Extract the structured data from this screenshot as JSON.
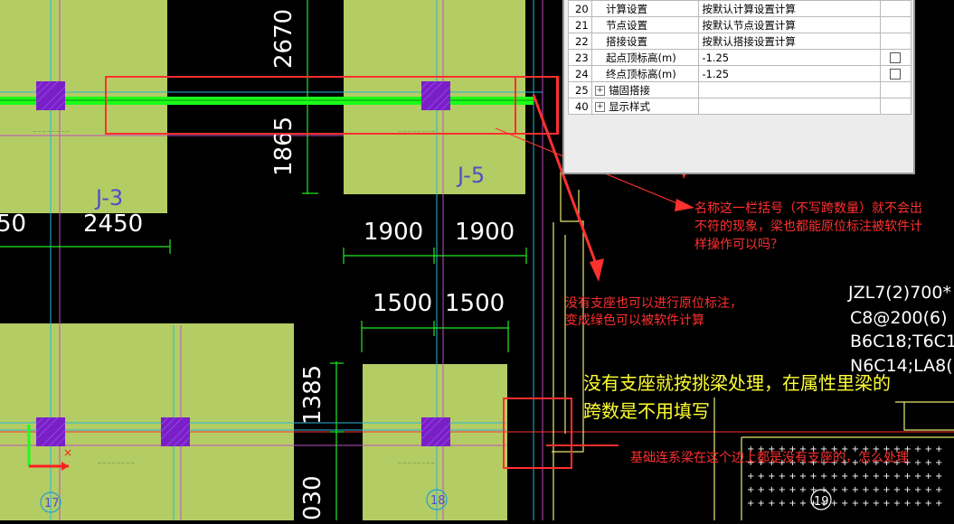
{
  "property_table": {
    "rows": [
      {
        "no": "20",
        "name": "计算设置",
        "value": "按默认计算设置计算",
        "indent": true,
        "expander": false,
        "checkbox": false
      },
      {
        "no": "21",
        "name": "节点设置",
        "value": "按默认节点设置计算",
        "indent": true,
        "expander": false,
        "checkbox": false
      },
      {
        "no": "22",
        "name": "搭接设置",
        "value": "按默认搭接设置计算",
        "indent": true,
        "expander": false,
        "checkbox": false
      },
      {
        "no": "23",
        "name": "起点顶标高(m)",
        "value": "-1.25",
        "indent": true,
        "expander": false,
        "checkbox": true
      },
      {
        "no": "24",
        "name": "终点顶标高(m)",
        "value": "-1.25",
        "indent": true,
        "expander": false,
        "checkbox": true
      },
      {
        "no": "25",
        "name": "锚固搭接",
        "value": "",
        "indent": false,
        "expander": true,
        "checkbox": false
      },
      {
        "no": "40",
        "name": "显示样式",
        "value": "",
        "indent": false,
        "expander": true,
        "checkbox": false
      }
    ]
  },
  "drawing": {
    "dimensions": {
      "d2670": "2670",
      "d1865": "1865",
      "d1385": "1385",
      "d030": "030",
      "d50": "50",
      "d2450": "2450",
      "d1900a": "1900",
      "d1900b": "1900",
      "d1500a": "1500",
      "d1500b": "1500"
    },
    "footing_labels": {
      "j3": "J-3",
      "j5": "J-5"
    },
    "axis_labels": {
      "a17": "17",
      "a18": "18",
      "a19": "19"
    },
    "beam_annotation": [
      "JZL7(2)700*",
      "C8@200(6)",
      "B6C18;T6C1",
      "N6C14;LA8("
    ]
  },
  "annotations": {
    "note_top": [
      "名称这一栏括号（不写跨数量）就不会出",
      "不符的现象，梁也都能原位标注被软件计",
      "样操作可以吗？"
    ],
    "note_mid": [
      "没有支座也可以进行原位标注，",
      "变成绿色可以被软件计算"
    ],
    "note_yellow": [
      "没有支座就按挑梁处理，在属性里梁的",
      "跨数是不用填写"
    ],
    "note_bottom": "基础连系梁在这个边上都是没有支座的，怎么处理"
  },
  "colors": {
    "footing": "#b4cc64",
    "column": "#7a1fc8",
    "beam_green": "#19ff19",
    "markup_red": "#ff3030",
    "note_yellow": "#ffff33",
    "dim_green": "#22e822",
    "grid_magenta": "#c050c0"
  }
}
